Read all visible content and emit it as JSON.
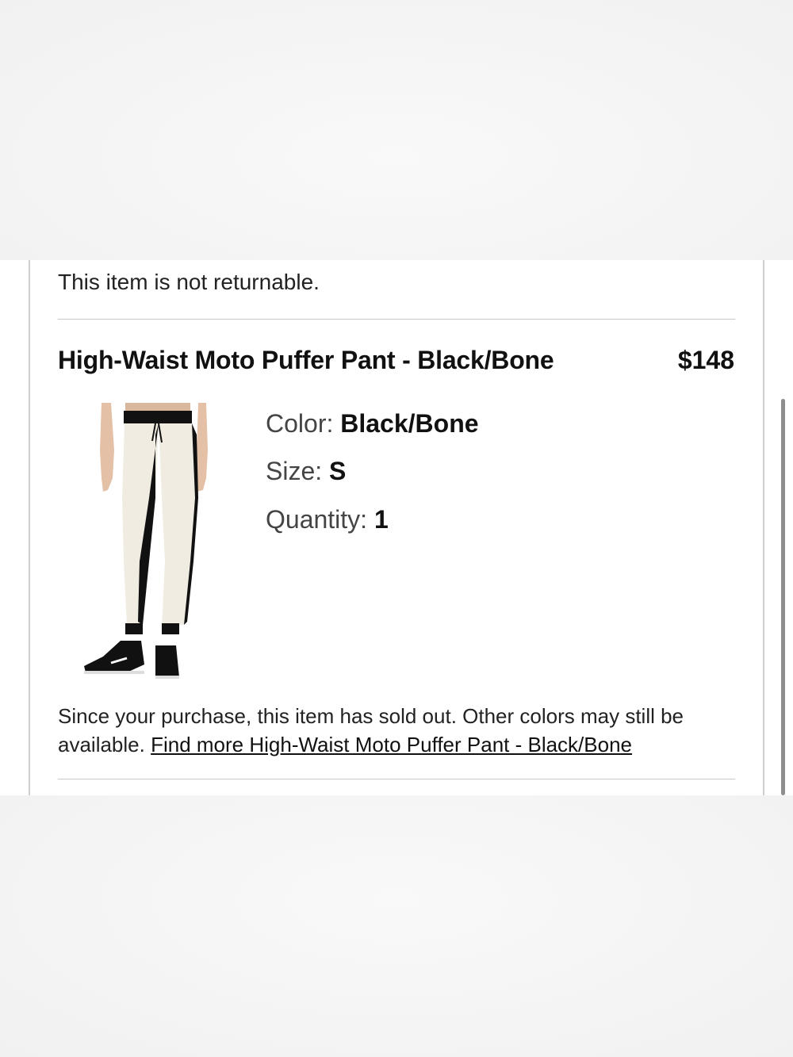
{
  "order_item": {
    "return_note": "This item is not returnable.",
    "title": "High-Waist Moto Puffer Pant - Black/Bone",
    "price": "$148",
    "image_alt": "High-Waist Moto Puffer Pant - Black/Bone",
    "color_label": "Color:",
    "color_value": "Black/Bone",
    "size_label": "Size:",
    "size_value": "S",
    "quantity_label": "Quantity:",
    "quantity_value": "1",
    "soldout_text": "Since your purchase, this item has sold out. Other colors may still be available.",
    "find_more_link": "Find more High-Waist Moto Puffer Pant - Black/Bone"
  },
  "colors": {
    "text": "#222222",
    "divider": "#c8c8c8",
    "pant_body": "#f1ece2",
    "pant_black": "#111111"
  }
}
